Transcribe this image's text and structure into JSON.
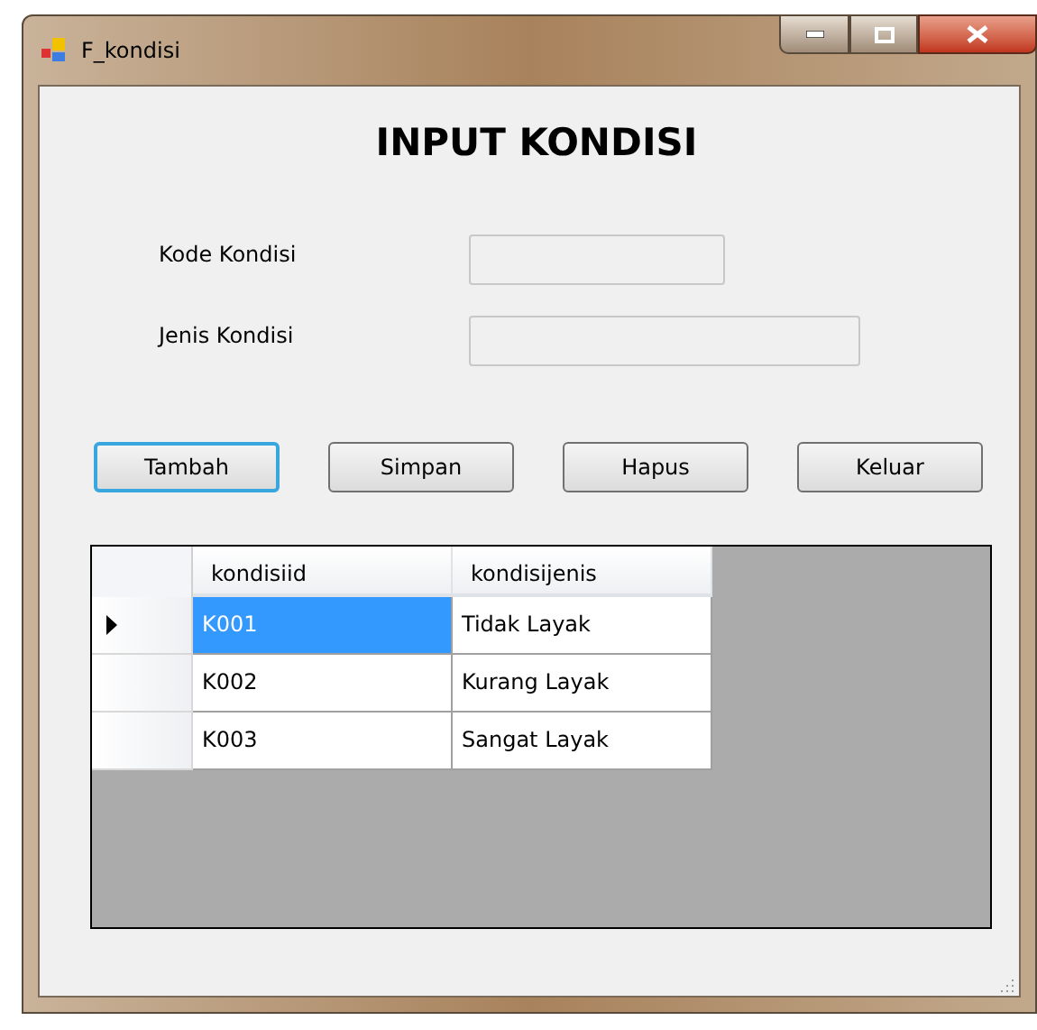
{
  "window": {
    "title": "F_kondisi"
  },
  "heading": "INPUT KONDISI",
  "fields": [
    {
      "label": "Kode Kondisi",
      "kind": "short"
    },
    {
      "label": "Jenis Kondisi",
      "kind": "long"
    }
  ],
  "buttons": [
    {
      "label": "Tambah",
      "focused": true
    },
    {
      "label": "Simpan",
      "focused": false
    },
    {
      "label": "Hapus",
      "focused": false
    },
    {
      "label": "Keluar",
      "focused": false
    }
  ],
  "table": {
    "columns": [
      "kondisiid",
      "kondisijenis"
    ],
    "rows": [
      {
        "current": true,
        "cells": [
          {
            "text": "K001",
            "selected": true
          },
          {
            "text": "Tidak Layak",
            "selected": false
          }
        ]
      },
      {
        "current": false,
        "cells": [
          {
            "text": "K002",
            "selected": false
          },
          {
            "text": "Kurang Layak",
            "selected": false
          }
        ]
      },
      {
        "current": false,
        "cells": [
          {
            "text": "K003",
            "selected": false
          },
          {
            "text": "Sangat Layak",
            "selected": false
          }
        ]
      }
    ]
  }
}
